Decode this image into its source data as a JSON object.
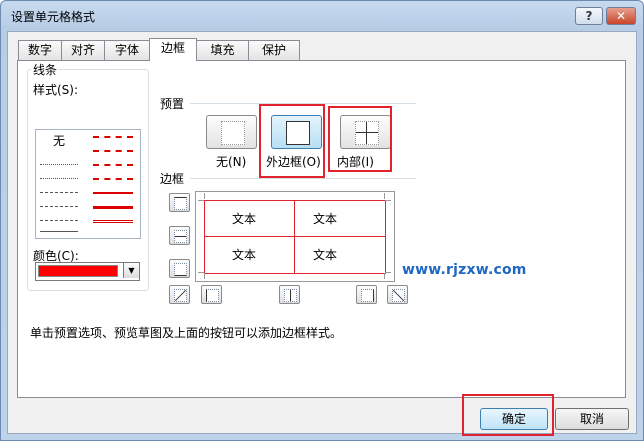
{
  "window": {
    "title": "设置单元格格式",
    "help_label": "?",
    "close_label": "✕"
  },
  "tabs": [
    {
      "label": "数字",
      "active": false
    },
    {
      "label": "对齐",
      "active": false
    },
    {
      "label": "字体",
      "active": false
    },
    {
      "label": "边框",
      "active": true
    },
    {
      "label": "填充",
      "active": false
    },
    {
      "label": "保护",
      "active": false
    }
  ],
  "line": {
    "group_label": "线条",
    "style_label": "样式(S):",
    "none_label": "无",
    "color_label": "颜色(C):",
    "color_value": "#ff0000",
    "dropdown_icon": "chevron-down-icon"
  },
  "presets": {
    "group_label": "预置",
    "items": [
      {
        "label": "无(N)",
        "icon": "border-none-icon"
      },
      {
        "label": "外边框(O)",
        "icon": "border-outline-icon"
      },
      {
        "label": "内部(I)",
        "icon": "border-inside-icon"
      }
    ]
  },
  "border": {
    "group_label": "边框",
    "preview_cells": [
      "文本",
      "文本",
      "文本",
      "文本"
    ],
    "line_color": "#e0232e"
  },
  "watermark": "www.rjzxw.com",
  "hint": "单击预置选项、预览草图及上面的按钮可以添加边框样式。",
  "buttons": {
    "ok": "确定",
    "cancel": "取消"
  }
}
